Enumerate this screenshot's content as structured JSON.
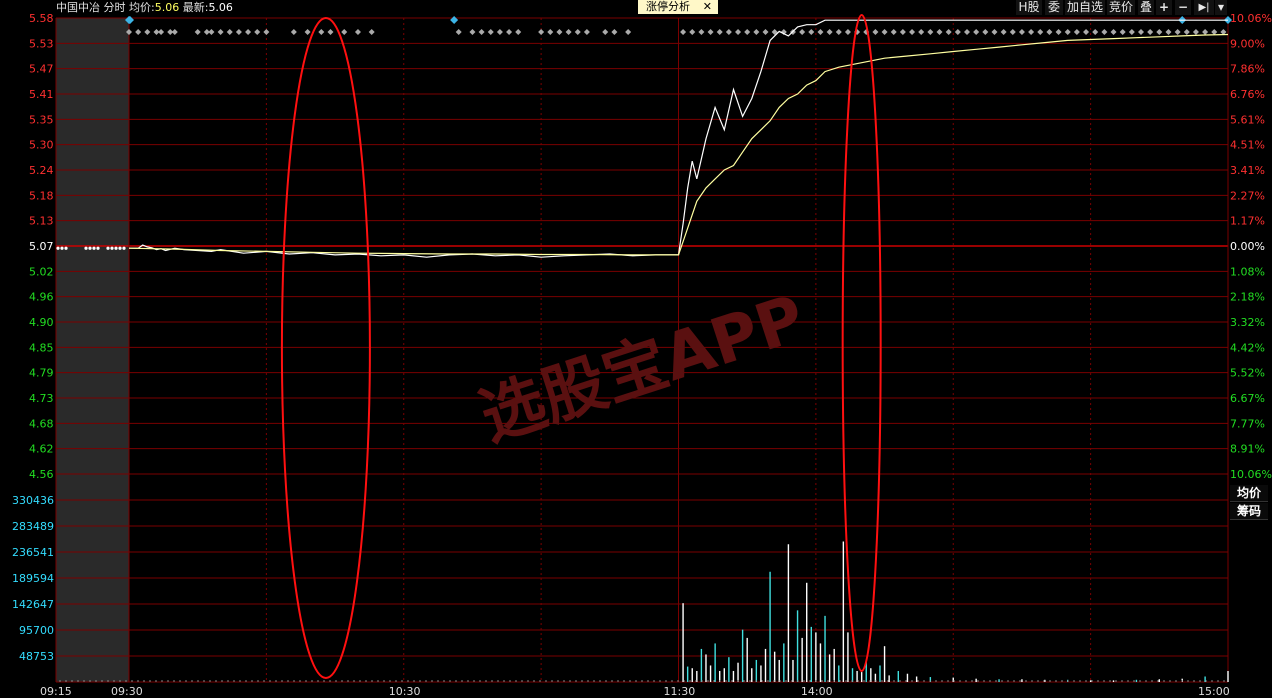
{
  "header": {
    "stock_name": "中国中冶",
    "mode": "分时",
    "avg_label": "均价:",
    "avg_value": "5.06",
    "last_label": "最新:",
    "last_value": "5.06",
    "analysis_tab": "涨停分析",
    "close_glyph": "✕"
  },
  "toolbar": {
    "h_shares": "H股",
    "entrust": "委",
    "add_watch": "加自选",
    "auction": "竞价",
    "overlay": "叠",
    "zoom_in": "+",
    "zoom_out": "−",
    "goto_end": "▶|",
    "menu": "▾"
  },
  "side_buttons": {
    "avg_price": "均价",
    "chips": "筹码"
  },
  "watermark": "选股宝APP",
  "colors": {
    "up": "#ff3030",
    "down": "#22dd22",
    "grid": "#7a0000",
    "price_line": "#ffffff",
    "avg_line": "#ffffa0",
    "volume_axis": "#33ddff",
    "annotation": "#ff1010"
  },
  "chart_data": {
    "type": "line",
    "prev_close": 5.07,
    "price_axis_left": [
      "5.58",
      "5.53",
      "5.47",
      "5.41",
      "5.35",
      "5.30",
      "5.24",
      "5.18",
      "5.13",
      "5.07",
      "5.02",
      "4.96",
      "4.90",
      "4.85",
      "4.79",
      "4.73",
      "4.68",
      "4.62",
      "4.56"
    ],
    "price_axis_right": [
      "10.06%",
      "9.00%",
      "7.86%",
      "6.76%",
      "5.61%",
      "4.51%",
      "3.41%",
      "2.27%",
      "1.17%",
      "0.00%",
      "1.08%",
      "2.18%",
      "3.32%",
      "4.42%",
      "5.52%",
      "6.67%",
      "7.77%",
      "8.91%",
      "10.06%"
    ],
    "ylim": [
      4.56,
      5.58
    ],
    "volume_axis": [
      "330436",
      "283489",
      "236541",
      "189594",
      "142647",
      "95700",
      "48753"
    ],
    "volume_max": 377383,
    "time_labels": [
      "09:15",
      "09:30",
      "10:30",
      "11:30",
      "14:00",
      "15:00"
    ],
    "series": [
      {
        "name": "",
        "t": [
          0,
          2,
          3,
          4,
          5,
          6,
          7,
          8,
          10,
          12,
          15,
          18,
          20,
          25,
          30,
          35,
          40,
          45,
          50,
          55,
          60,
          65,
          70,
          75,
          80,
          85,
          90,
          95,
          100,
          105,
          110,
          115,
          120,
          121,
          122,
          123,
          124,
          126,
          128,
          130,
          132,
          134,
          136,
          138,
          140,
          142,
          144,
          146,
          148,
          150,
          152,
          154,
          156,
          158,
          160,
          165,
          170,
          175,
          180,
          185,
          190,
          195,
          200,
          205,
          210,
          215,
          220,
          225,
          230,
          235,
          240
        ],
        "values": [
          5.065,
          5.065,
          5.072,
          5.068,
          5.066,
          5.062,
          5.064,
          5.06,
          5.065,
          5.062,
          5.06,
          5.058,
          5.062,
          5.054,
          5.058,
          5.052,
          5.055,
          5.05,
          5.052,
          5.048,
          5.05,
          5.045,
          5.05,
          5.052,
          5.048,
          5.05,
          5.045,
          5.048,
          5.05,
          5.052,
          5.048,
          5.05,
          5.05,
          5.12,
          5.2,
          5.26,
          5.22,
          5.31,
          5.38,
          5.33,
          5.42,
          5.36,
          5.4,
          5.46,
          5.53,
          5.55,
          5.54,
          5.56,
          5.565,
          5.565,
          5.575,
          5.575,
          5.575,
          5.575,
          5.575,
          5.575,
          5.575,
          5.575,
          5.575,
          5.575,
          5.575,
          5.575,
          5.575,
          5.575,
          5.575,
          5.575,
          5.575,
          5.575,
          5.575,
          5.575,
          5.575
        ]
      },
      {
        "name": "均价",
        "t": [
          0,
          10,
          20,
          30,
          40,
          50,
          60,
          70,
          80,
          90,
          100,
          110,
          120,
          122,
          124,
          126,
          128,
          130,
          132,
          134,
          136,
          138,
          140,
          142,
          144,
          146,
          148,
          150,
          152,
          155,
          160,
          165,
          170,
          175,
          180,
          185,
          190,
          195,
          200,
          205,
          210,
          215,
          220,
          225,
          230,
          235,
          240
        ],
        "values": [
          5.065,
          5.063,
          5.06,
          5.058,
          5.056,
          5.054,
          5.053,
          5.052,
          5.052,
          5.051,
          5.051,
          5.05,
          5.05,
          5.11,
          5.17,
          5.2,
          5.22,
          5.24,
          5.25,
          5.28,
          5.31,
          5.33,
          5.35,
          5.38,
          5.4,
          5.41,
          5.43,
          5.44,
          5.46,
          5.47,
          5.48,
          5.49,
          5.495,
          5.5,
          5.505,
          5.51,
          5.515,
          5.52,
          5.525,
          5.53,
          5.532,
          5.534,
          5.536,
          5.538,
          5.54,
          5.542,
          5.543
        ]
      }
    ],
    "volume": {
      "t": [
        121,
        122,
        123,
        124,
        125,
        126,
        127,
        128,
        129,
        130,
        131,
        132,
        133,
        134,
        135,
        136,
        137,
        138,
        139,
        140,
        141,
        142,
        143,
        144,
        145,
        146,
        147,
        148,
        149,
        150,
        151,
        152,
        153,
        154,
        155,
        156,
        157,
        158,
        159,
        160,
        161,
        162,
        163,
        164,
        165,
        166,
        168,
        170,
        172,
        175,
        180,
        185,
        190,
        195,
        200,
        205,
        210,
        215,
        220,
        225,
        230,
        235,
        240
      ],
      "values": [
        143000,
        28000,
        25000,
        20000,
        60000,
        50000,
        30000,
        70000,
        20000,
        25000,
        45000,
        20000,
        35000,
        95000,
        80000,
        25000,
        40000,
        30000,
        60000,
        200000,
        55000,
        40000,
        70000,
        250000,
        40000,
        130000,
        80000,
        180000,
        100000,
        90000,
        70000,
        120000,
        50000,
        60000,
        30000,
        255000,
        90000,
        25000,
        20000,
        18000,
        40000,
        25000,
        15000,
        30000,
        65000,
        12000,
        20000,
        15000,
        10000,
        9000,
        8000,
        6000,
        5000,
        5000,
        4000,
        4000,
        3000,
        3000,
        4000,
        5000,
        6000,
        10000,
        20000
      ]
    },
    "annotations": [
      "ellipse around 11:50 spike",
      "ellipse around 14:05 spike"
    ]
  }
}
